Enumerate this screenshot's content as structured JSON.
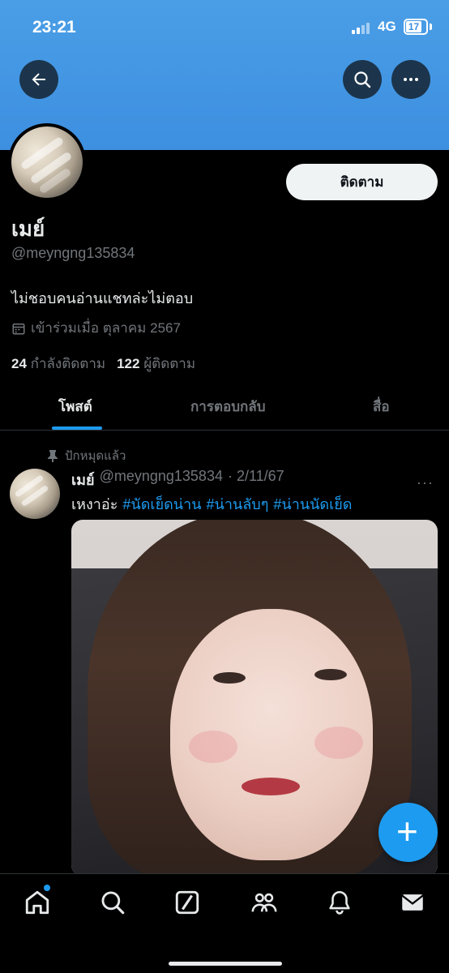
{
  "status_bar": {
    "time": "23:21",
    "network": "4G",
    "battery": "17"
  },
  "profile": {
    "display_name": "เมย์",
    "handle": "@meyngng135834",
    "bio": "ไม่ชอบคนอ่านแชทล่ะไม่ตอบ",
    "joined": "เข้าร่วมเมื่อ ตุลาคม 2567",
    "following_count": "24",
    "following_label": "กำลังติดตาม",
    "followers_count": "122",
    "followers_label": "ผู้ติดตาม",
    "follow_button": "ติดตาม"
  },
  "tabs": [
    {
      "label": "โพสต์",
      "active": true
    },
    {
      "label": "การตอบกลับ",
      "active": false
    },
    {
      "label": "สื่อ",
      "active": false
    }
  ],
  "post": {
    "pinned_label": "ปักหมุดแล้ว",
    "name": "เมย์",
    "handle": "@meyngng135834",
    "date": "· 2/11/67",
    "text_prefix": "เหงาอ่ะ",
    "hashtags": [
      "#นัดเย็ดน่าน",
      "#น่านลับๆ",
      "#น่านนัดเย็ด"
    ],
    "more": "···"
  },
  "fab": {
    "label": "+"
  },
  "bottom_nav": [
    "home-icon",
    "search-icon",
    "grok-icon",
    "communities-icon",
    "notifications-icon",
    "messages-icon"
  ],
  "colors": {
    "accent": "#1d9bf0",
    "banner": "#4a9ee6",
    "background": "#000000",
    "muted": "#71767b"
  }
}
